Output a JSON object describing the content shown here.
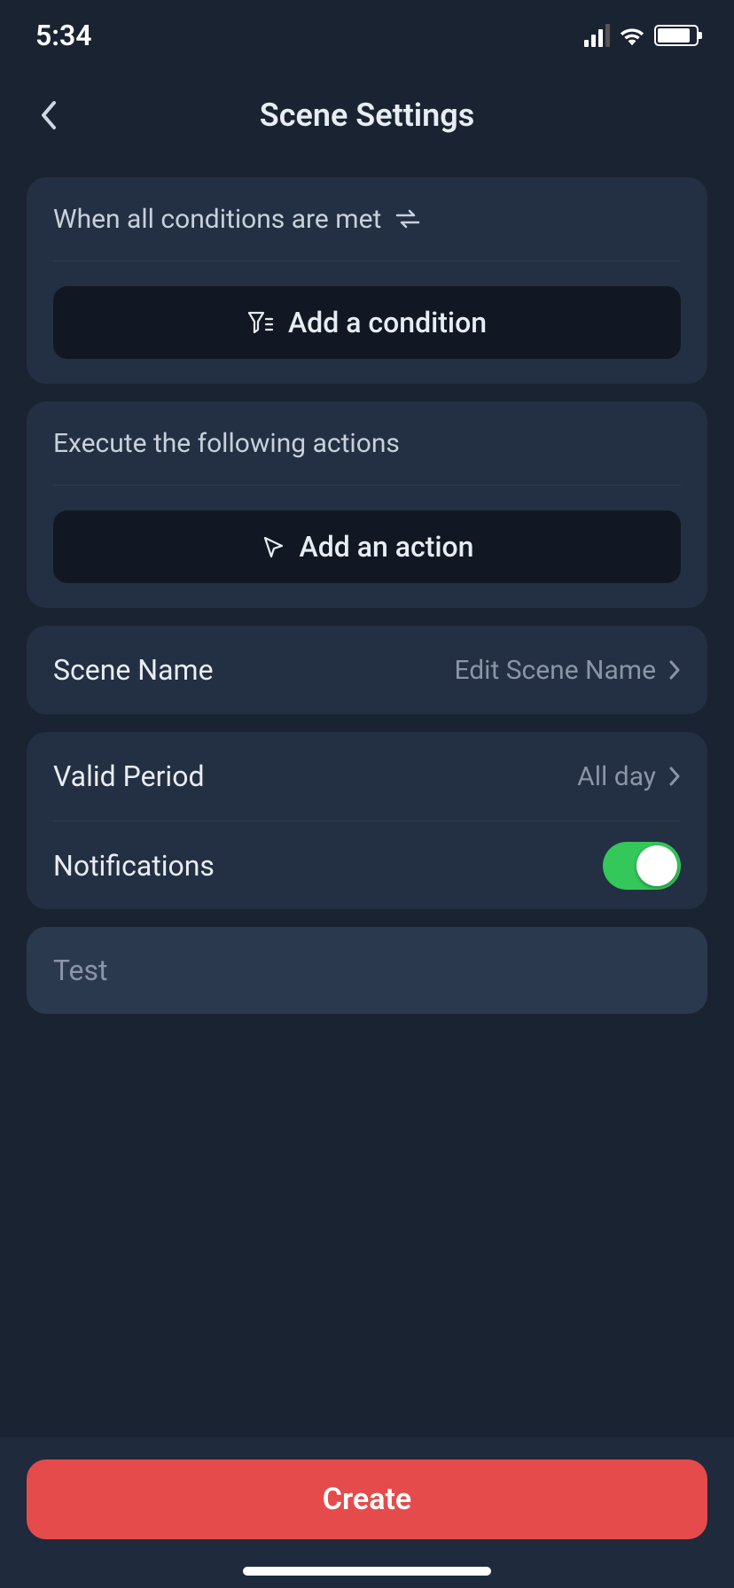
{
  "status": {
    "time": "5:34"
  },
  "nav": {
    "title": "Scene Settings"
  },
  "conditions": {
    "header": "When all conditions are met",
    "add_label": "Add a condition"
  },
  "actions": {
    "header": "Execute the following actions",
    "add_label": "Add an action"
  },
  "scene_name": {
    "label": "Scene Name",
    "value": "Edit Scene Name"
  },
  "valid_period": {
    "label": "Valid Period",
    "value": "All day"
  },
  "notifications": {
    "label": "Notifications",
    "enabled": true
  },
  "test": {
    "label": "Test"
  },
  "footer": {
    "create_label": "Create"
  }
}
